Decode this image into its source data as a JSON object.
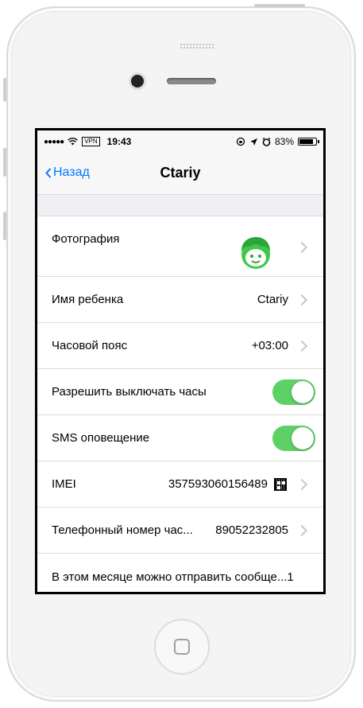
{
  "status_bar": {
    "signal": "●●●●●",
    "vpn": "VPN",
    "time": "19:43",
    "battery": "83%",
    "battery_level": 0.83
  },
  "nav": {
    "back_label": "Назад",
    "title": "Ctariy"
  },
  "rows": {
    "photo": {
      "label": "Фотография"
    },
    "child_name": {
      "label": "Имя ребенка",
      "value": "Ctariy"
    },
    "timezone": {
      "label": "Часовой пояс",
      "value": "+03:00"
    },
    "allow_off": {
      "label": "Разрешить выключать часы",
      "on": true
    },
    "sms": {
      "label": "SMS оповещение",
      "on": true
    },
    "imei": {
      "label": "IMEI",
      "value": "357593060156489"
    },
    "phone": {
      "label": "Телефонный номер час...",
      "value": "89052232805"
    },
    "messages": {
      "label": "В этом месяце можно отправить сообще...1"
    }
  },
  "colors": {
    "accent": "#007aff",
    "toggle_on": "#5ed166",
    "avatar": "#3fc84a"
  }
}
